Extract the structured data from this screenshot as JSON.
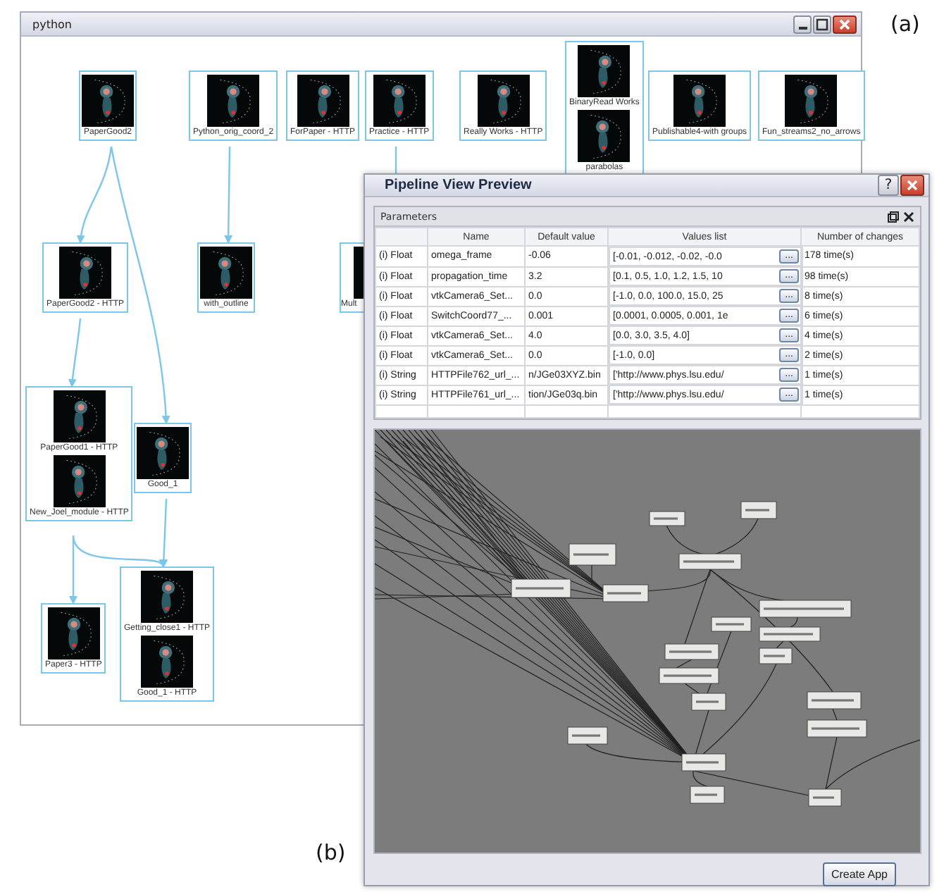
{
  "panel_labels": [
    "(a)",
    "(b)"
  ],
  "python_window": {
    "title": "python",
    "nodes": [
      {
        "items": [
          "PaperGood2"
        ]
      },
      {
        "items": [
          "Python_orig_coord_2"
        ]
      },
      {
        "items": [
          "ForPaper - HTTP"
        ]
      },
      {
        "items": [
          "Practice - HTTP"
        ]
      },
      {
        "items": [
          "Really Works - HTTP"
        ]
      },
      {
        "items": [
          "BinaryRead Works",
          "parabolas"
        ]
      },
      {
        "items": [
          "Publishable4-with groups"
        ]
      },
      {
        "items": [
          "Fun_streams2_no_arrows"
        ]
      },
      {
        "items": [
          "PaperGood2 - HTTP"
        ]
      },
      {
        "items": [
          "with_outline"
        ]
      },
      {
        "items": [
          "Mult"
        ]
      },
      {
        "items": [
          "PaperGood1 - HTTP",
          "New_Joel_module - HTTP"
        ]
      },
      {
        "items": [
          "Good_1"
        ]
      },
      {
        "items": [
          "Paper3 - HTTP"
        ]
      },
      {
        "items": [
          "Getting_close1 - HTTP",
          "Good_1 - HTTP"
        ]
      }
    ]
  },
  "pipeline_dialog": {
    "title": "Pipeline View Preview",
    "help_button": "?",
    "parameters": {
      "title": "Parameters",
      "columns": [
        "Name",
        "Default value",
        "Values list",
        "Number of changes"
      ],
      "rows": [
        {
          "type": "(i) Float",
          "name": "omega_frame",
          "default": "-0.06",
          "values": "[-0.01, -0.012, -0.02, -0.0",
          "more": "...",
          "changes": "178 time(s)"
        },
        {
          "type": "(i) Float",
          "name": "propagation_time",
          "default": "3.2",
          "values": "[0.1, 0.5, 1.0, 1.2, 1.5, 10",
          "more": "...",
          "changes": "98 time(s)"
        },
        {
          "type": "(i) Float",
          "name": "vtkCamera6_Set...",
          "default": "0.0",
          "values": "[-1.0, 0.0, 100.0, 15.0, 25",
          "more": "...",
          "changes": "8 time(s)"
        },
        {
          "type": "(i) Float",
          "name": "SwitchCoord77_...",
          "default": "0.001",
          "values": "[0.0001, 0.0005, 0.001, 1e",
          "more": "...",
          "changes": "6 time(s)"
        },
        {
          "type": "(i) Float",
          "name": "vtkCamera6_Set...",
          "default": "4.0",
          "values": "[0.0, 3.0, 3.5, 4.0]",
          "more": "...",
          "changes": "4 time(s)"
        },
        {
          "type": "(i) Float",
          "name": "vtkCamera6_Set...",
          "default": "0.0",
          "values": "[-1.0, 0.0]",
          "more": "...",
          "changes": "2 time(s)"
        },
        {
          "type": "(i) String",
          "name": "HTTPFile762_url_...",
          "default": "n/JGe03XYZ.bin",
          "values": "['http://www.phys.lsu.edu/",
          "more": "...",
          "changes": "1 time(s)"
        },
        {
          "type": "(i) String",
          "name": "HTTPFile761_url_...",
          "default": "tion/JGe03q.bin",
          "values": "['http://www.phys.lsu.edu/",
          "more": "...",
          "changes": "1 time(s)"
        }
      ]
    },
    "create_button": "Create App"
  }
}
